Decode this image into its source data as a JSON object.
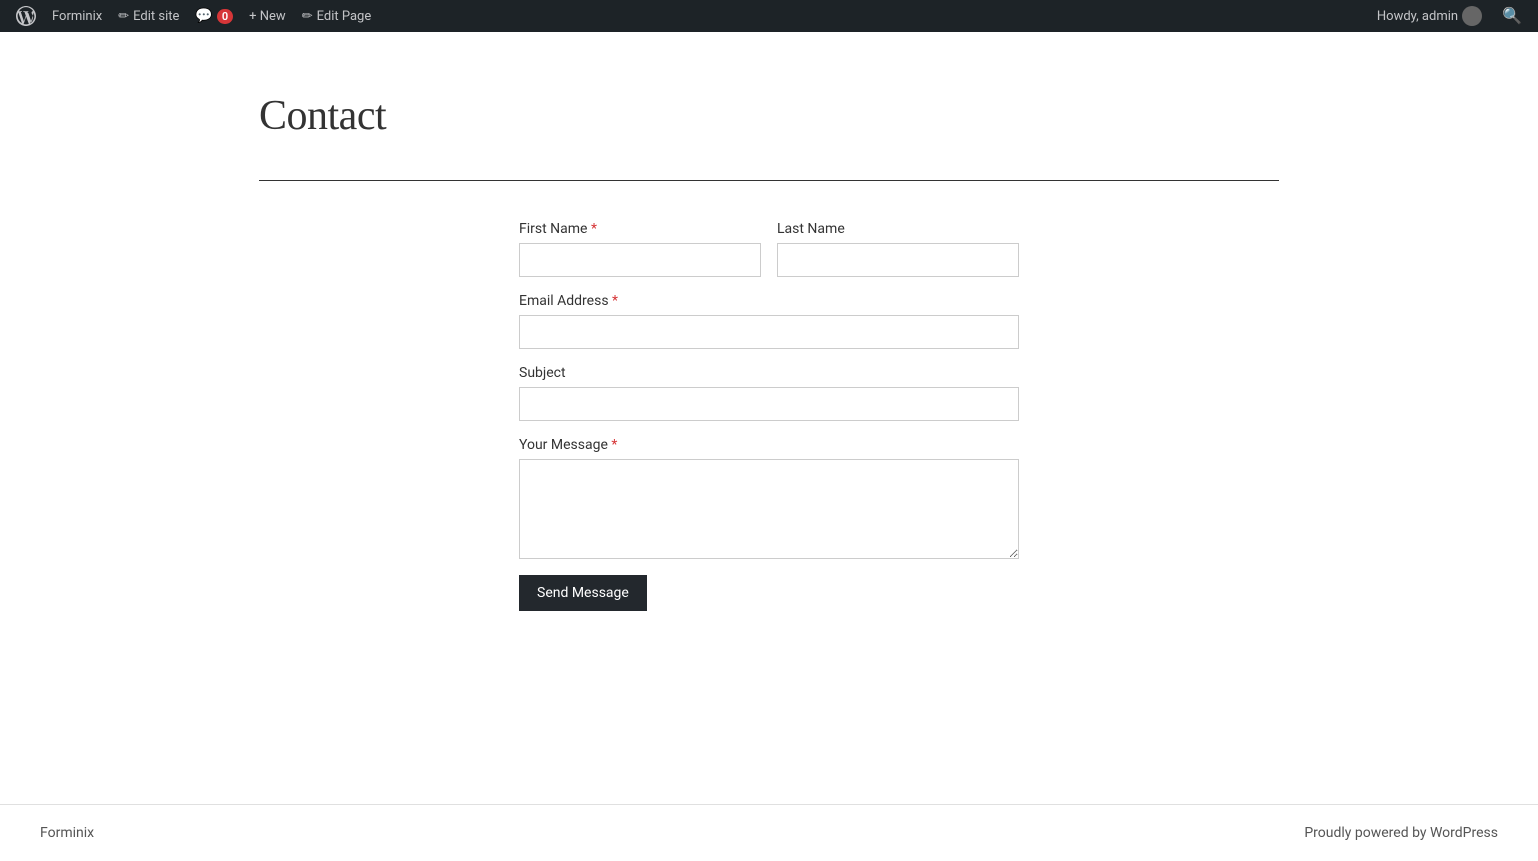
{
  "adminbar": {
    "wp_logo_alt": "WordPress",
    "site_name": "Forminix",
    "edit_site_label": "Edit site",
    "comments_count": "0",
    "new_label": "+ New",
    "edit_page_label": "Edit Page",
    "howdy_label": "Howdy, admin",
    "search_icon": "🔍"
  },
  "page": {
    "title": "Contact",
    "divider": true
  },
  "form": {
    "first_name_label": "First Name",
    "first_name_required": "*",
    "last_name_label": "Last Name",
    "email_label": "Email Address",
    "email_required": "*",
    "subject_label": "Subject",
    "message_label": "Your Message",
    "message_required": "*",
    "submit_label": "Send Message"
  },
  "footer": {
    "brand_label": "Forminix",
    "powered_text": "Proudly powered by ",
    "wp_label": "WordPress"
  }
}
